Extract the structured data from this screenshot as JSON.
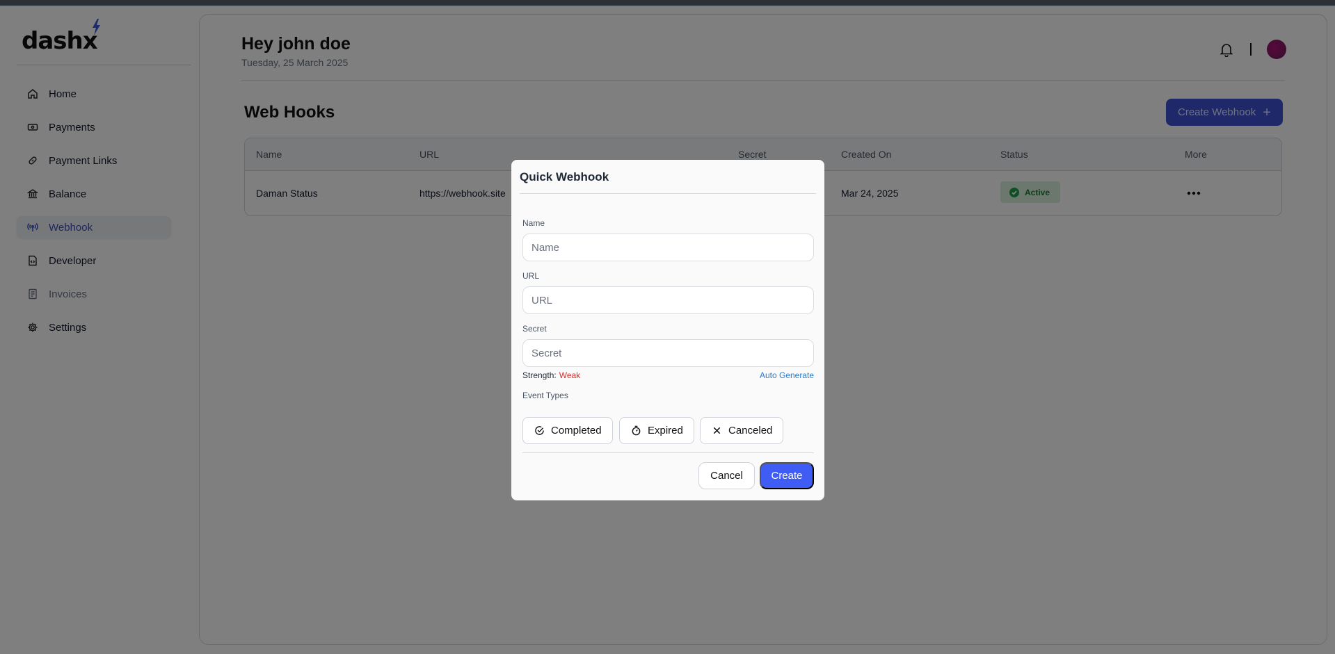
{
  "app": {
    "logo_text": "dash",
    "logo_x": "x"
  },
  "sidebar": {
    "items": [
      {
        "label": "Home",
        "icon": "home-icon"
      },
      {
        "label": "Payments",
        "icon": "payments-icon"
      },
      {
        "label": "Payment Links",
        "icon": "link-icon"
      },
      {
        "label": "Balance",
        "icon": "bank-icon"
      },
      {
        "label": "Webhook",
        "icon": "broadcast-icon",
        "active": true
      },
      {
        "label": "Developer",
        "icon": "developer-file-icon"
      },
      {
        "label": "Invoices",
        "icon": "invoice-icon",
        "muted": true
      },
      {
        "label": "Settings",
        "icon": "gear-icon"
      }
    ]
  },
  "header": {
    "greeting": "Hey john doe",
    "date": "Tuesday, 25 March 2025"
  },
  "page": {
    "title": "Web Hooks",
    "create_button": "Create Webhook",
    "create_button_icon": "+"
  },
  "table": {
    "columns": [
      "Name",
      "URL",
      "Secret",
      "Created On",
      "Status",
      "More"
    ],
    "rows": [
      {
        "name": "Daman Status",
        "url": "https://webhook.site",
        "created_on": "Mar 24, 2025",
        "status": "Active"
      }
    ]
  },
  "modal": {
    "title": "Quick Webhook",
    "name_label": "Name",
    "name_placeholder": "Name",
    "url_label": "URL",
    "url_placeholder": "URL",
    "secret_label": "Secret",
    "secret_placeholder": "Secret",
    "strength_label": "Strength:",
    "strength_value": "Weak",
    "auto_generate": "Auto Generate",
    "event_types_label": "Event Types",
    "event_types": [
      {
        "label": "Completed",
        "icon": "check-circle-icon"
      },
      {
        "label": "Expired",
        "icon": "stopwatch-icon"
      },
      {
        "label": "Canceled",
        "icon": "x-icon"
      }
    ],
    "cancel_label": "Cancel",
    "create_label": "Create"
  },
  "colors": {
    "accent": "#3e50d3",
    "create_button": "#3f5cf5",
    "active_badge_bg": "#d8f0dc",
    "active_badge_text": "#1f7a3a",
    "weak": "#d32f2f",
    "link": "#2b7bd3"
  }
}
